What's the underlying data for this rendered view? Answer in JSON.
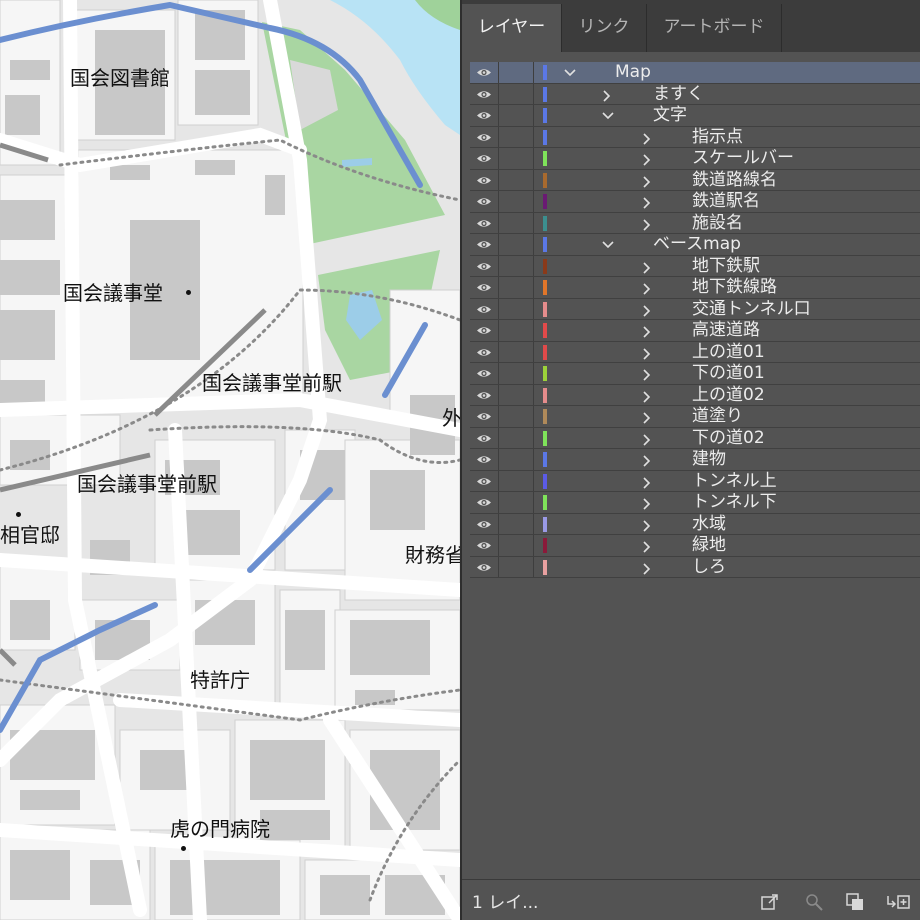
{
  "map": {
    "labels": {
      "kokkai_toshokan": "国会図書館",
      "kokkai_gijido": "国会議事堂",
      "station1": "国会議事堂前駅",
      "station2": "国会議事堂前駅",
      "shusho_kantei": "相官邸",
      "zaimusho": "財務省",
      "tokkyocho": "特許庁",
      "toranomon": "虎の門病院",
      "gaimu": "外"
    }
  },
  "panel": {
    "tabs": [
      "レイヤー",
      "リンク",
      "アートボード"
    ],
    "active_tab": "レイヤー",
    "layers": [
      {
        "name": "Map",
        "level": 0,
        "expanded": true,
        "color": "#5b78e6",
        "selected": true
      },
      {
        "name": "ますく",
        "level": 1,
        "expanded": false,
        "color": "#5b78e6"
      },
      {
        "name": "文字",
        "level": 1,
        "expanded": true,
        "color": "#5b78e6"
      },
      {
        "name": "指示点",
        "level": 2,
        "expanded": false,
        "color": "#5b78e6"
      },
      {
        "name": "スケールバー",
        "level": 2,
        "expanded": false,
        "color": "#7fe35a"
      },
      {
        "name": "鉄道路線名",
        "level": 2,
        "expanded": false,
        "color": "#a86a2e"
      },
      {
        "name": "鉄道駅名",
        "level": 2,
        "expanded": false,
        "color": "#6a1a73"
      },
      {
        "name": "施設名",
        "level": 2,
        "expanded": false,
        "color": "#3c8f8f"
      },
      {
        "name": "ベースmap",
        "level": 1,
        "expanded": true,
        "color": "#5b78e6"
      },
      {
        "name": "地下鉄駅",
        "level": 2,
        "expanded": false,
        "color": "#8a3a1a"
      },
      {
        "name": "地下鉄線路",
        "level": 2,
        "expanded": false,
        "color": "#e0762a"
      },
      {
        "name": "交通トンネル口",
        "level": 2,
        "expanded": false,
        "color": "#e58c8c"
      },
      {
        "name": "高速道路",
        "level": 2,
        "expanded": false,
        "color": "#e24a4a"
      },
      {
        "name": "上の道01",
        "level": 2,
        "expanded": false,
        "color": "#e04a4a"
      },
      {
        "name": "下の道01",
        "level": 2,
        "expanded": false,
        "color": "#9cd23a"
      },
      {
        "name": "上の道02",
        "level": 2,
        "expanded": false,
        "color": "#e58c8c"
      },
      {
        "name": "道塗り",
        "level": 2,
        "expanded": false,
        "color": "#b08a5a"
      },
      {
        "name": "下の道02",
        "level": 2,
        "expanded": false,
        "color": "#7fe35a"
      },
      {
        "name": "建物",
        "level": 2,
        "expanded": false,
        "color": "#5b78e6"
      },
      {
        "name": "トンネル上",
        "level": 2,
        "expanded": false,
        "color": "#5b5be6"
      },
      {
        "name": "トンネル下",
        "level": 2,
        "expanded": false,
        "color": "#7fe35a"
      },
      {
        "name": "水域",
        "level": 2,
        "expanded": false,
        "color": "#9a9ae6"
      },
      {
        "name": "緑地",
        "level": 2,
        "expanded": false,
        "color": "#8a1a3a"
      },
      {
        "name": "しろ",
        "level": 2,
        "expanded": false,
        "color": "#e8a0a0"
      }
    ],
    "footer": {
      "count_text": "1 レイ...",
      "icons": [
        "export-icon",
        "locate-icon",
        "clip-mask-icon",
        "new-sublayer-icon"
      ]
    }
  }
}
